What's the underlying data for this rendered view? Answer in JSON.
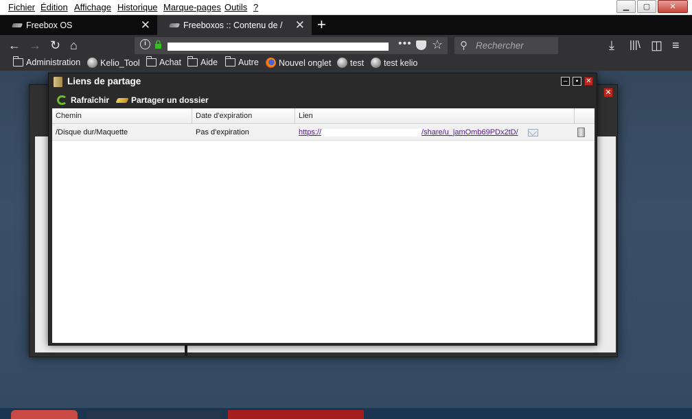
{
  "menubar": {
    "items": [
      "Fichier",
      "Édition",
      "Affichage",
      "Historique",
      "Marque-pages",
      "Outils",
      "?"
    ]
  },
  "tabs": [
    {
      "title": "Freebox OS",
      "active": true
    },
    {
      "title": "Freeboxos :: Contenu de /",
      "active": false
    }
  ],
  "navbar": {
    "search_placeholder": "Rechercher"
  },
  "bookmarks": [
    {
      "label": "Administration",
      "icon": "folder-icon"
    },
    {
      "label": "Kelio_Tool",
      "icon": "globe-icon"
    },
    {
      "label": "Achat",
      "icon": "folder-icon"
    },
    {
      "label": "Aide",
      "icon": "folder-icon"
    },
    {
      "label": "Autre",
      "icon": "folder-icon"
    },
    {
      "label": "Nouvel onglet",
      "icon": "firefox-icon"
    },
    {
      "label": "test",
      "icon": "globe-icon"
    },
    {
      "label": "test kelio",
      "icon": "globe-icon"
    }
  ],
  "dialog": {
    "title": "Liens de partage",
    "toolbar": {
      "refresh": "Rafraîchir",
      "share_folder": "Partager un dossier"
    },
    "columns": {
      "path": "Chemin",
      "expiry": "Date d'expiration",
      "link": "Lien"
    },
    "rows": [
      {
        "path": "/Disque dur/Maquette",
        "expiry": "Pas d'expiration",
        "link_start": "https://",
        "link_end": "/share/u_jamOmb69PDx2tD/"
      }
    ]
  },
  "colors": {
    "accent_close": "#c0281f",
    "refresh_green": "#6bbf2a",
    "link_visited": "#551a8b"
  }
}
